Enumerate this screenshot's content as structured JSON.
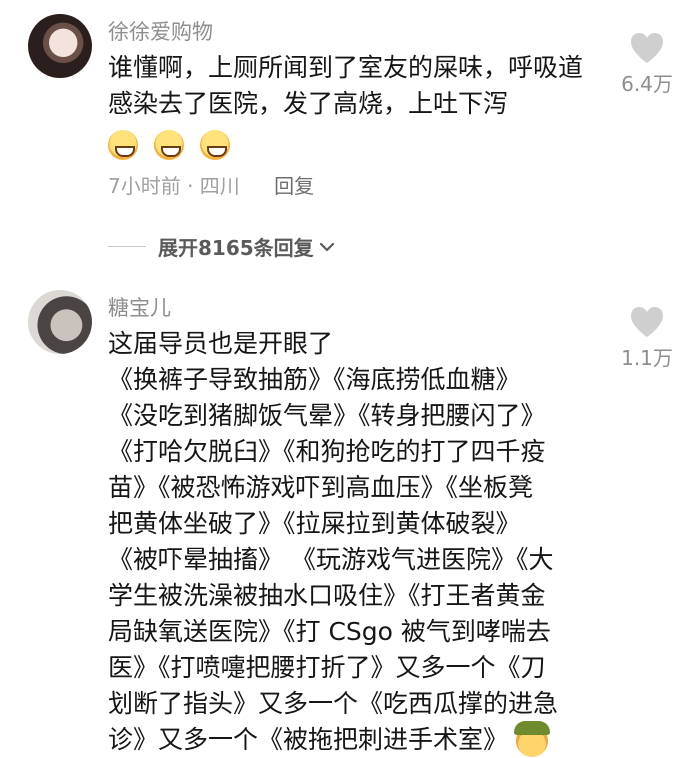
{
  "comments": [
    {
      "username": "徐徐爱购物",
      "text": "谁懂啊，上厕所闻到了室友的屎味，呼吸道感染去了医院，发了高烧，上吐下泻",
      "emoji": [
        "grinning-sweat-emoji",
        "grinning-sweat-emoji",
        "grinning-sweat-emoji"
      ],
      "likes": "6.4万",
      "time_location": "7小时前 · 四川",
      "reply_label": "回复",
      "expand_label": "展开8165条回复"
    },
    {
      "username": "糖宝儿",
      "text_lines": [
        "这届导员也是开眼了",
        "《换裤子导致抽筋》《海底捞低血糖》",
        "《没吃到猪脚饭气晕》《转身把腰闪了》",
        "《打哈欠脱臼》《和狗抢吃的打了四千疫",
        "苗》《被恐怖游戏吓到高血压》《坐板凳",
        "把黄体坐破了》《拉屎拉到黄体破裂》",
        "《被吓晕抽搐》 《玩游戏气进医院》《大",
        "学生被洗澡被抽水口吸住》《打王者黄金",
        "局缺氧送医院》《打 CSgo 被气到哮喘去",
        "医》《打喷嚏把腰打折了》又多一个《刀",
        "划断了指头》又多一个《吃西瓜撑的进急",
        "诊》又多一个《被拖把刺进手术室》"
      ],
      "likes": "1.1万",
      "trailing_emoji": "army-helmet-emoji"
    }
  ],
  "colors": {
    "text": "#161616",
    "muted": "#8e8e8e",
    "heart": "#cfcfcf"
  }
}
